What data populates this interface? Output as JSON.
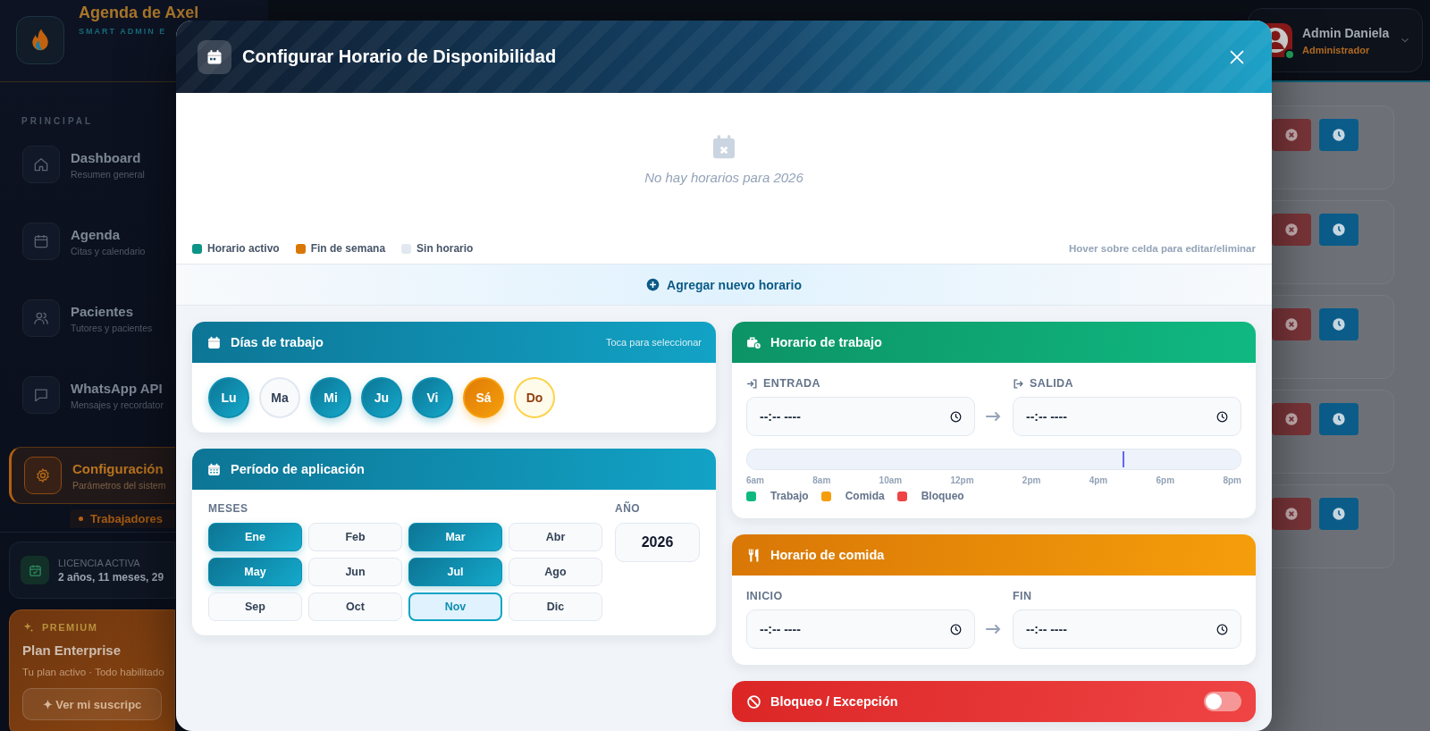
{
  "sidebar": {
    "brand": {
      "title": "Agenda de Axel",
      "subtitle": "SMART ADMIN E"
    },
    "section_label": "PRINCIPAL",
    "items": [
      {
        "label": "Dashboard",
        "sublabel": "Resumen general",
        "selected": false
      },
      {
        "label": "Agenda",
        "sublabel": "Citas y calendario",
        "selected": false
      },
      {
        "label": "Pacientes",
        "sublabel": "Tutores y pacientes",
        "selected": false
      },
      {
        "label": "WhatsApp API",
        "sublabel": "Mensajes y recordator",
        "selected": false
      },
      {
        "label": "Configuración",
        "sublabel": "Parámetros del sistem",
        "selected": true,
        "children": [
          {
            "label": "Trabajadores"
          }
        ]
      }
    ],
    "license": {
      "label": "LICENCIA ACTIVA",
      "value": "2 años, 11 meses, 29"
    },
    "premium": {
      "badge": "PREMIUM",
      "title": "Plan Enterprise",
      "description": "Tu plan activo · Todo habilitado",
      "button": "✦ Ver mi suscripc"
    }
  },
  "header": {
    "user": {
      "name": "Admin Daniela",
      "role": "Administrador",
      "online": true
    }
  },
  "list_rows": [
    {
      "actions": [
        {
          "kind": "cancel"
        },
        {
          "kind": "clock"
        }
      ]
    },
    {
      "actions": [
        {
          "kind": "cancel"
        },
        {
          "kind": "clock"
        }
      ]
    },
    {
      "actions": [
        {
          "kind": "cancel"
        },
        {
          "kind": "clock"
        }
      ]
    },
    {
      "actions": [
        {
          "kind": "cancel"
        },
        {
          "kind": "clock"
        }
      ]
    },
    {
      "actions": [
        {
          "kind": "cancel"
        },
        {
          "kind": "clock"
        }
      ]
    }
  ],
  "modal": {
    "title": "Configurar Horario de Disponibilidad",
    "empty_state": "No hay horarios para 2026",
    "legend": [
      {
        "label": "Horario activo",
        "color": "#0d9488"
      },
      {
        "label": "Fin de semana",
        "color": "#d97706"
      },
      {
        "label": "Sin horario",
        "color": "#e2e8f0"
      }
    ],
    "hint": "Hover sobre celda para editar/eliminar",
    "add_button": "Agregar nuevo horario",
    "days_card": {
      "title": "Días de trabajo",
      "hint": "Toca para seleccionar",
      "days": [
        {
          "label": "Lu",
          "kind": "weekday",
          "selected": true
        },
        {
          "label": "Ma",
          "kind": "weekday",
          "selected": false
        },
        {
          "label": "Mi",
          "kind": "weekday",
          "selected": true
        },
        {
          "label": "Ju",
          "kind": "weekday",
          "selected": true
        },
        {
          "label": "Vi",
          "kind": "weekday",
          "selected": true
        },
        {
          "label": "Sá",
          "kind": "weekend",
          "selected": true
        },
        {
          "label": "Do",
          "kind": "weekend",
          "selected": false
        }
      ]
    },
    "period_card": {
      "title": "Período de aplicación",
      "months_label": "MESES",
      "year_label": "AÑO",
      "year": "2026",
      "months": [
        {
          "label": "Ene",
          "selected": true,
          "focused": false
        },
        {
          "label": "Feb",
          "selected": false,
          "focused": false
        },
        {
          "label": "Mar",
          "selected": true,
          "focused": false
        },
        {
          "label": "Abr",
          "selected": false,
          "focused": false
        },
        {
          "label": "May",
          "selected": true,
          "focused": false
        },
        {
          "label": "Jun",
          "selected": false,
          "focused": false
        },
        {
          "label": "Jul",
          "selected": true,
          "focused": false
        },
        {
          "label": "Ago",
          "selected": false,
          "focused": false
        },
        {
          "label": "Sep",
          "selected": false,
          "focused": false
        },
        {
          "label": "Oct",
          "selected": false,
          "focused": false
        },
        {
          "label": "Nov",
          "selected": false,
          "focused": true
        },
        {
          "label": "Dic",
          "selected": false,
          "focused": false
        }
      ]
    },
    "work_card": {
      "title": "Horario de trabajo",
      "start": {
        "label": "ENTRADA",
        "placeholder": "--:-- ----"
      },
      "end": {
        "label": "SALIDA",
        "placeholder": "--:-- ----"
      },
      "timeline": {
        "level": 0.76,
        "ticks": [
          "6am",
          "8am",
          "10am",
          "12pm",
          "2pm",
          "4pm",
          "6pm",
          "8pm"
        ]
      },
      "legend": [
        {
          "label": "Trabajo",
          "color": "#10b981"
        },
        {
          "label": "Comida",
          "color": "#f59e0b"
        },
        {
          "label": "Bloqueo",
          "color": "#ef4444"
        }
      ]
    },
    "lunch_card": {
      "title": "Horario de comida",
      "start": {
        "label": "INICIO",
        "placeholder": "--:-- ----"
      },
      "end": {
        "label": "FIN",
        "placeholder": "--:-- ----"
      }
    },
    "block_card": {
      "title": "Bloqueo / Excepción",
      "on": false
    }
  }
}
